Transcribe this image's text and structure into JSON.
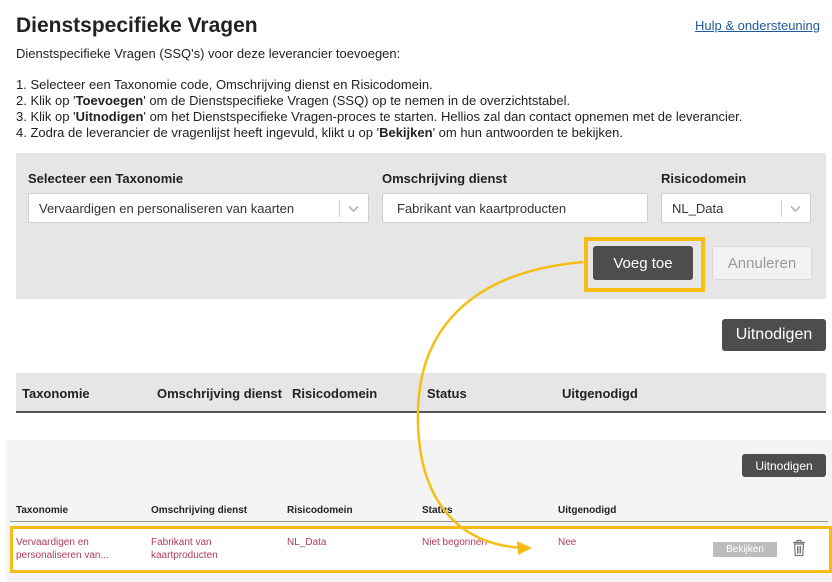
{
  "header": {
    "title": "Dienstspecifieke Vragen",
    "help_link": "Hulp & ondersteuning",
    "intro": "Dienstspecifieke Vragen (SSQ's) voor deze leverancier toevoegen:"
  },
  "steps": [
    {
      "pre": "1. Selecteer een Taxonomie code, Omschrijving dienst en Risicodomein.",
      "bold": "",
      "post": ""
    },
    {
      "pre": "2. Klik op '",
      "bold": "Toevoegen",
      "post": "' om de Dienstspecifieke Vragen (SSQ) op te nemen in de overzichtstabel."
    },
    {
      "pre": "3. Klik op '",
      "bold": "Uitnodigen",
      "post": "' om het Dienstspecifieke Vragen-proces te starten. Hellios zal dan contact opnemen met de leverancier."
    },
    {
      "pre": "4. Zodra de leverancier de vragenlijst heeft ingevuld, klikt u op '",
      "bold": "Bekijken",
      "post": "' om hun antwoorden te bekijken."
    }
  ],
  "form": {
    "taxonomy_label": "Selecteer een Taxonomie",
    "taxonomy_value": "Vervaardigen en personaliseren van kaarten",
    "description_label": "Omschrijving dienst",
    "description_value": "Fabrikant van kaartproducten",
    "risk_label": "Risicodomein",
    "risk_value": "NL_Data",
    "add_button": "Voeg toe",
    "cancel_button": "Annuleren"
  },
  "invite_button": "Uitnodigen",
  "table": {
    "columns": [
      "Taxonomie",
      "Omschrijving dienst",
      "Risicodomein",
      "Status",
      "Uitgenodigd"
    ]
  },
  "bottom": {
    "invite_button": "Uitnodigen",
    "columns": [
      "Taxonomie",
      "Omschrijving dienst",
      "Risicodomein",
      "Status",
      "Uitgenodigd"
    ],
    "row": {
      "taxonomy_line1": "Vervaardigen en",
      "taxonomy_line2": "personaliseren van...",
      "description_line1": "Fabrikant van",
      "description_line2": "kaartproducten",
      "risk": "NL_Data",
      "status": "Niet begonnen",
      "invited": "Nee",
      "view_button": "Bekijken"
    }
  },
  "colors": {
    "highlight": "#f6be14",
    "primary_button": "#4d4d4d",
    "row_text": "#b03a5b",
    "link": "#1f5a9e"
  },
  "icons": [
    "chevron-down-icon",
    "trash-icon",
    "arrow-curve-icon"
  ]
}
